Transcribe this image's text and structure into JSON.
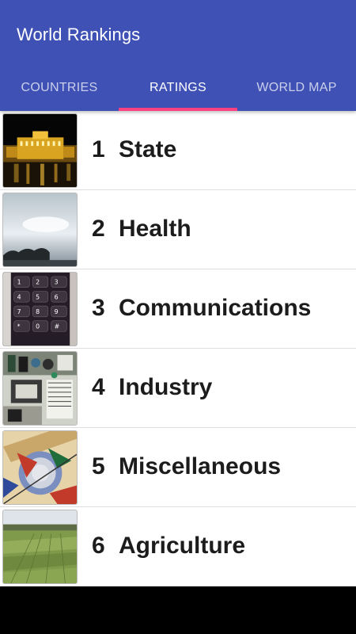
{
  "app": {
    "title": "World Rankings"
  },
  "tabs": [
    {
      "label": "COUNTRIES"
    },
    {
      "label": "RATINGS"
    },
    {
      "label": "WORLD MAP"
    }
  ],
  "colors": {
    "primary": "#3f51b5",
    "accent": "#ff4081"
  },
  "ratings": [
    {
      "rank": "1",
      "label": "State",
      "image": "palace-at-night"
    },
    {
      "rank": "2",
      "label": "Health",
      "image": "sea-sky"
    },
    {
      "rank": "3",
      "label": "Communications",
      "image": "phone-keypad"
    },
    {
      "rank": "4",
      "label": "Industry",
      "image": "circuit-board"
    },
    {
      "rank": "5",
      "label": "Miscellaneous",
      "image": "abstract-mosaic"
    },
    {
      "rank": "6",
      "label": "Agriculture",
      "image": "field"
    }
  ]
}
